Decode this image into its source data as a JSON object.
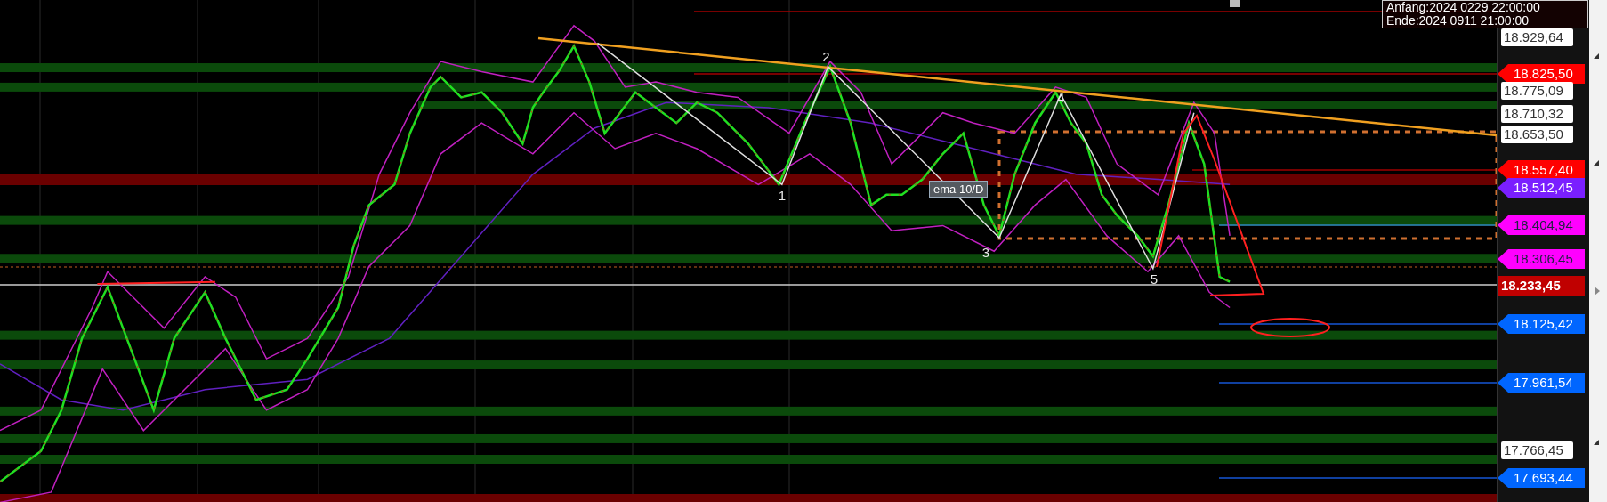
{
  "header_box": {
    "start": "Anfang:2024 0229 22:00:00",
    "end": "Ende:2024 0911 21:00:00"
  },
  "chart": {
    "wave_labels": [
      "1",
      "2",
      "3",
      "4",
      "5"
    ],
    "indicator_label": "ema 10/D"
  },
  "price_axis": {
    "labels": [
      {
        "text": "18.929,64",
        "kind": "plain"
      },
      {
        "text": "18.825,50",
        "kind": "flag",
        "color": "#ff0000"
      },
      {
        "text": "18.775,09",
        "kind": "plain"
      },
      {
        "text": "18.710,32",
        "kind": "plain"
      },
      {
        "text": "18.653,50",
        "kind": "plain"
      },
      {
        "text": "18.557,40",
        "kind": "flag",
        "color": "#ff0000"
      },
      {
        "text": "18.512,45",
        "kind": "flag",
        "color": "#7a1fff"
      },
      {
        "text": "18.404,94",
        "kind": "flag",
        "color": "#ff00ff"
      },
      {
        "text": "18.306,45",
        "kind": "flag",
        "color": "#ff00ff"
      },
      {
        "text": "18.233,45",
        "kind": "current",
        "color": "#c00000"
      },
      {
        "text": "18.125,42",
        "kind": "flag",
        "color": "#0066ff"
      },
      {
        "text": "17.961,54",
        "kind": "flag",
        "color": "#0066ff"
      },
      {
        "text": "17.766,45",
        "kind": "plain"
      },
      {
        "text": "17.693,44",
        "kind": "flag",
        "color": "#0066ff"
      }
    ]
  }
}
